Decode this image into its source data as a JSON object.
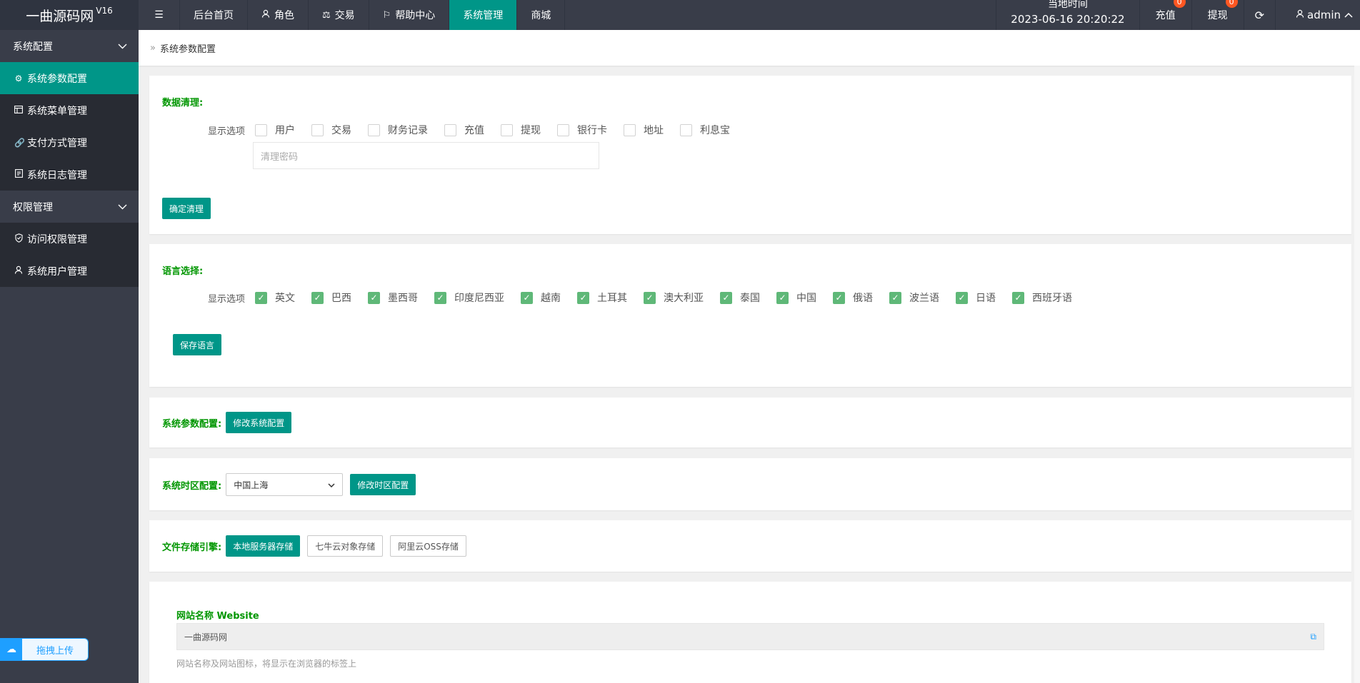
{
  "header": {
    "logo_text": "一曲源码网",
    "logo_version": "V16",
    "menu_icon": "menu-icon",
    "nav": [
      {
        "label": "后台首页"
      },
      {
        "label": "角色",
        "icon": "user-icon"
      },
      {
        "label": "交易",
        "icon": "scale-icon"
      },
      {
        "label": "帮助中心",
        "icon": "flag-icon"
      },
      {
        "label": "系统管理"
      },
      {
        "label": "商城"
      }
    ],
    "time_label": "当地时间",
    "time_value": "2023-06-16 20:20:22",
    "recharge_label": "充值",
    "recharge_count": "0",
    "withdraw_label": "提现",
    "withdraw_count": "0",
    "refresh_icon": "refresh-icon",
    "user_name": "admin"
  },
  "sidebar": {
    "groups": [
      {
        "label": "系统配置",
        "items": [
          "系统参数配置",
          "系统菜单管理",
          "支付方式管理",
          "系统日志管理"
        ]
      },
      {
        "label": "权限管理",
        "items": [
          "访问权限管理",
          "系统用户管理"
        ]
      }
    ],
    "upload_label": "拖拽上传"
  },
  "breadcrumb": "系统参数配置",
  "data_clean": {
    "title": "数据清理:",
    "options_label": "显示选项",
    "options": [
      "用户",
      "交易",
      "财务记录",
      "充值",
      "提现",
      "银行卡",
      "地址",
      "利息宝"
    ],
    "password_placeholder": "清理密码",
    "confirm_label": "确定清理"
  },
  "language": {
    "title": "语言选择:",
    "options_label": "显示选项",
    "options": [
      "英文",
      "巴西",
      "墨西哥",
      "印度尼西亚",
      "越南",
      "土耳其",
      "澳大利亚",
      "泰国",
      "中国",
      "俄语",
      "波兰语",
      "日语",
      "西班牙语"
    ],
    "save_label": "保存语言"
  },
  "sys_param": {
    "title": "系统参数配置:",
    "button": "修改系统配置"
  },
  "timezone": {
    "title": "系统时区配置:",
    "selected": "中国上海",
    "button": "修改时区配置"
  },
  "storage": {
    "title": "文件存储引擎:",
    "options": [
      "本地服务器存储",
      "七牛云对象存储",
      "阿里云OSS存储"
    ]
  },
  "website": {
    "title": "网站名称 Website",
    "value": "一曲源码网",
    "hint": "网站名称及网站图标，将显示在浏览器的标签上"
  },
  "colors": {
    "accent": "#009688",
    "header_bg": "#393d49",
    "title_green": "#009600",
    "check_green": "#5fb878"
  }
}
